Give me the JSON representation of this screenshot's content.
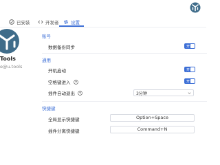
{
  "tabs": [
    {
      "label": "已安装",
      "icon": "circle-check-icon",
      "active": false
    },
    {
      "label": "开发者",
      "icon": "code-icon",
      "active": false
    },
    {
      "label": "设置",
      "icon": "gear-icon",
      "active": true
    }
  ],
  "sidebar": {
    "name": "Tools",
    "email": "e@u.tools"
  },
  "settings": {
    "account": {
      "title": "账号",
      "data_sync_label": "数据备份同步",
      "data_sync_toggle": "开"
    },
    "general": {
      "title": "通用",
      "autostart_label": "开机启动",
      "autostart_toggle": "开",
      "space_label": "空格键进入",
      "space_toggle": "开",
      "plugin_exit_label": "插件自动退出",
      "plugin_exit_value": "3分钟"
    },
    "shortcuts": {
      "title": "快捷键",
      "global_label": "全局显示快捷键",
      "global_value": "Option+Space",
      "detach_label": "插件分离快捷键",
      "detach_value": "Command+N"
    }
  },
  "colors": {
    "accent": "#3d6fd6",
    "logo": "#3f6c8a"
  }
}
